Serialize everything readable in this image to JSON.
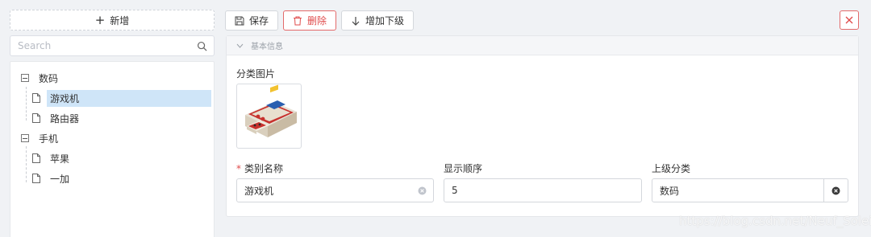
{
  "sidebar": {
    "add_button_label": "新增",
    "search_placeholder": "Search",
    "tree": [
      {
        "label": "数码",
        "children": [
          "游戏机",
          "路由器"
        ],
        "selected_child": "游戏机"
      },
      {
        "label": "手机",
        "children": [
          "苹果",
          "一加"
        ]
      }
    ]
  },
  "toolbar": {
    "save_label": "保存",
    "delete_label": "删除",
    "add_child_label": "增加下级"
  },
  "form": {
    "section_title": "基本信息",
    "image_label": "分类图片",
    "name_label": "类别名称",
    "name_value": "游戏机",
    "order_label": "显示顺序",
    "order_value": "5",
    "parent_label": "上级分类",
    "parent_value": "数码"
  },
  "watermark": "https://blog.csdn.net/Neuf_Soleil",
  "colors": {
    "accent_red": "#e04b4b",
    "selected_bg": "#cfe5f8",
    "page_bg": "#f0f2f5"
  },
  "icons": {
    "search": "search-icon",
    "save": "save-icon",
    "delete": "trash-icon",
    "add_child": "arrow-down-icon",
    "close": "close-icon",
    "collapse": "chevron-down-icon",
    "tree_toggle": "minus-square-icon",
    "leaf": "file-icon"
  }
}
